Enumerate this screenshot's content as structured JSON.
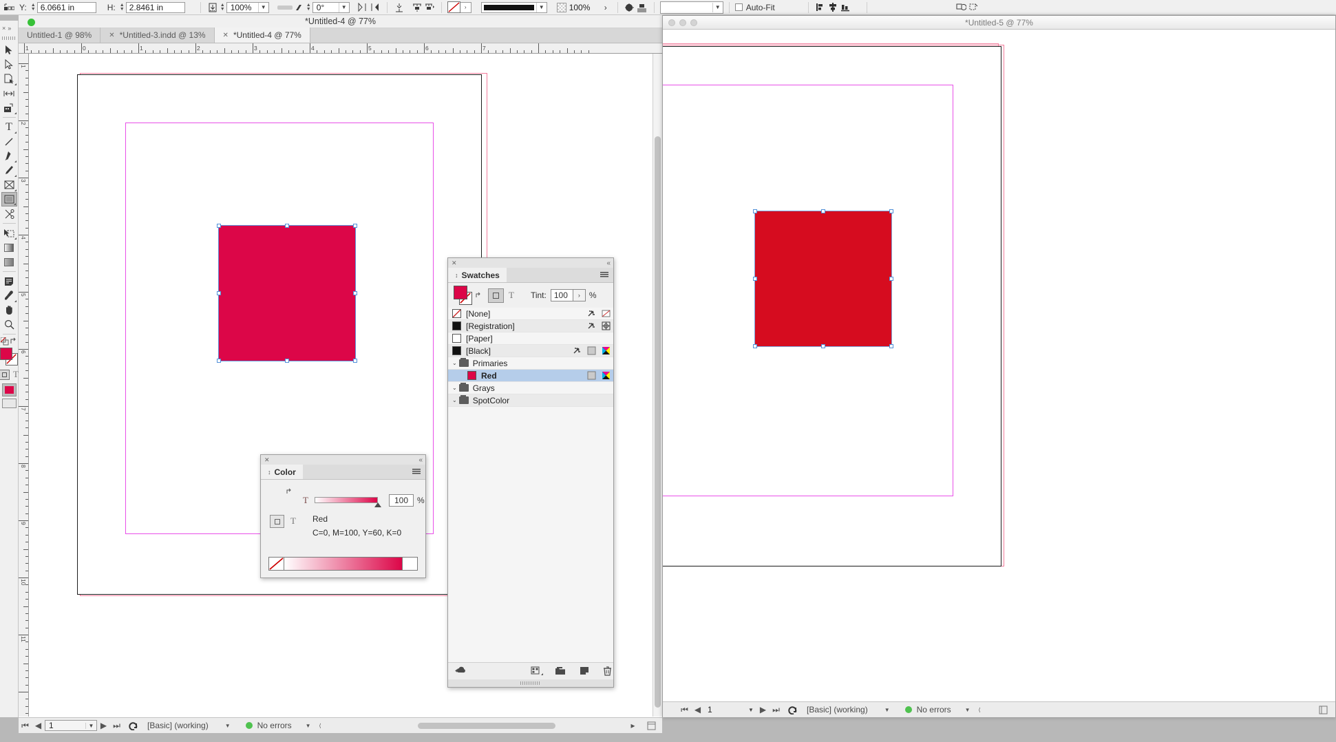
{
  "control_bar": {
    "y_label": "Y:",
    "y_value": "6.0661 in",
    "h_label": "H:",
    "h_value": "2.8461 in",
    "scale_value": "100%",
    "rotate_value": "0°",
    "stroke_weight_value": "100%",
    "opacity_value": "100%",
    "autofit_label": "Auto-Fit",
    "icons": [
      "reference-point-icon",
      "text-frame-options-icon",
      "align-icon",
      "distribute-icon",
      "no-stroke-icon",
      "stroke-style-icon",
      "drop-shadow-icon",
      "text-wrap-icon",
      "frame-fitting-icon",
      "align-left-icon",
      "align-center-icon",
      "align-bottom-icon",
      "select-container-icon",
      "select-content-icon"
    ]
  },
  "toolbar": {
    "close_label": "×",
    "expand_label": "»",
    "tools": [
      {
        "name": "selection-tool",
        "glyph": "▶",
        "selected": false
      },
      {
        "name": "direct-selection-tool",
        "glyph": "▷",
        "selected": false
      },
      {
        "name": "page-tool",
        "glyph": "page",
        "selected": false
      },
      {
        "name": "gap-tool",
        "glyph": "gap",
        "selected": false
      },
      {
        "name": "content-collector-tool",
        "glyph": "collector",
        "selected": false
      },
      {
        "name": "type-tool",
        "glyph": "T",
        "selected": false
      },
      {
        "name": "line-tool",
        "glyph": "line",
        "selected": false
      },
      {
        "name": "pen-tool",
        "glyph": "pen",
        "selected": false
      },
      {
        "name": "pencil-tool",
        "glyph": "pencil",
        "selected": false
      },
      {
        "name": "frame-tool",
        "glyph": "frame",
        "selected": false
      },
      {
        "name": "rectangle-tool",
        "glyph": "rect",
        "selected": true
      },
      {
        "name": "scissors-tool",
        "glyph": "scissors",
        "selected": false
      },
      {
        "name": "free-transform-tool",
        "glyph": "transform",
        "selected": false
      },
      {
        "name": "gradient-swatch-tool",
        "glyph": "gradient",
        "selected": false
      },
      {
        "name": "gradient-feather-tool",
        "glyph": "feather",
        "selected": false
      },
      {
        "name": "note-tool",
        "glyph": "note",
        "selected": false
      },
      {
        "name": "eyedropper-tool",
        "glyph": "eyedropper",
        "selected": false
      },
      {
        "name": "hand-tool",
        "glyph": "hand",
        "selected": false
      },
      {
        "name": "zoom-tool",
        "glyph": "zoom",
        "selected": false
      }
    ],
    "fill_color": "#DC0648",
    "stroke_color": "#FFFFFF"
  },
  "left_window": {
    "title": "*Untitled-4 @ 77%",
    "tabs": [
      {
        "label": "Untitled-1 @ 98%",
        "active": false,
        "closable": false
      },
      {
        "label": "*Untitled-3.indd @ 13%",
        "active": false,
        "closable": true
      },
      {
        "label": "*Untitled-4 @ 77%",
        "active": true,
        "closable": true
      }
    ],
    "ruler_h_labels": [
      "1",
      "0",
      "1",
      "2",
      "3",
      "4",
      "5",
      "6",
      "7"
    ],
    "rect_fill": "#DC0648",
    "status": {
      "page_value": "1",
      "preflight_profile": "[Basic] (working)",
      "errors": "No errors",
      "first_label": "⏮",
      "prev_label": "◀",
      "next_label": "▶",
      "last_label": "⏭"
    }
  },
  "right_window": {
    "title": "*Untitled-5 @ 77%",
    "rect_fill": "#D60C1F",
    "status": {
      "page_value": "1",
      "preflight_profile": "[Basic] (working)",
      "errors": "No errors"
    }
  },
  "swatches_panel": {
    "tab_label": "Swatches",
    "tint_label": "Tint:",
    "tint_value": "100",
    "tint_unit": "%",
    "proxy_fill": "#DC0648",
    "formatting_text_label": "T",
    "rows": [
      {
        "label": "[None]",
        "chip": "none",
        "indent": 0,
        "kind": "swatch",
        "selected": false,
        "icons": [
          "no-print-icon",
          "none-icon"
        ]
      },
      {
        "label": "[Registration]",
        "chip": "#111111",
        "indent": 0,
        "kind": "swatch",
        "selected": false,
        "icons": [
          "no-print-icon",
          "registration-icon"
        ]
      },
      {
        "label": "[Paper]",
        "chip": "#ffffff",
        "indent": 0,
        "kind": "swatch",
        "selected": false,
        "icons": []
      },
      {
        "label": "[Black]",
        "chip": "#111111",
        "indent": 0,
        "kind": "swatch",
        "selected": false,
        "icons": [
          "no-print-icon",
          "tint-icon",
          "cmyk-icon"
        ]
      },
      {
        "label": "Primaries",
        "chip": "folder",
        "indent": 0,
        "kind": "group",
        "selected": false,
        "icons": []
      },
      {
        "label": "Red",
        "chip": "#DC0648",
        "indent": 1,
        "kind": "swatch",
        "selected": true,
        "icons": [
          "tint-icon",
          "cmyk-icon"
        ]
      },
      {
        "label": "Grays",
        "chip": "folder",
        "indent": 0,
        "kind": "group",
        "selected": false,
        "icons": []
      },
      {
        "label": "SpotColor",
        "chip": "folder",
        "indent": 0,
        "kind": "group",
        "selected": false,
        "icons": []
      }
    ],
    "footer_icons": [
      "show-all-icon",
      "new-color-group-icon",
      "new-swatch-icon",
      "duplicate-swatch-icon",
      "delete-swatch-icon"
    ]
  },
  "color_panel": {
    "tab_label": "Color",
    "tint_letter": "T",
    "tint_value": "100",
    "tint_unit": "%",
    "swatch_name": "Red",
    "color_values": "C=0, M=100, Y=60, K=0",
    "formatting_text_label": "T",
    "ramp_color": "#DC0648"
  }
}
